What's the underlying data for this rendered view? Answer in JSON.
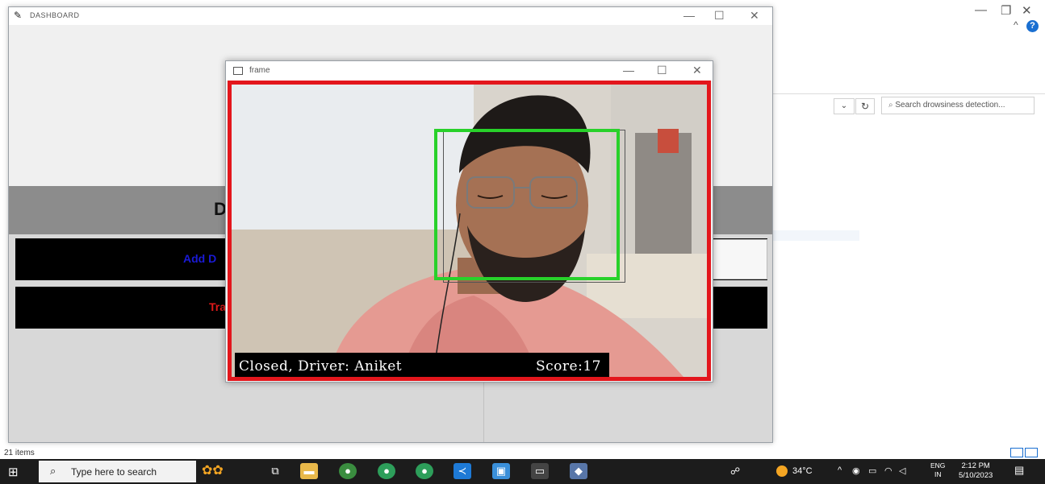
{
  "explorer": {
    "search_placeholder": "Search drowsiness detection...",
    "items_count": "21 items",
    "win_minimize": "—",
    "win_restore": "❐",
    "win_close": "✕",
    "help": "?",
    "caret": "^",
    "dropdown": "⌄",
    "refresh": "↻"
  },
  "dashboard": {
    "title": "DASHBOARD",
    "header_visible": "D",
    "add_button_visible": "Add D",
    "train_button_visible": "Tra",
    "colors": {
      "add_label": "#1a1ad6",
      "train_label": "#e01a1a",
      "header_bg": "#8c8c8c"
    },
    "win_minimize": "—",
    "win_maximize": "☐",
    "win_close": "✕"
  },
  "frame": {
    "title": "frame",
    "status": "Closed, Driver: Aniket",
    "score": "Score:17",
    "win_minimize": "—",
    "win_maximize": "☐",
    "win_close": "✕",
    "colors": {
      "border": "#e3161c",
      "face_box": "#28d12a"
    }
  },
  "taskbar": {
    "search_placeholder": "Type here to search",
    "temperature": "34°C",
    "lang_top": "ENG",
    "lang_bottom": "IN",
    "time": "2:12 PM",
    "date": "5/10/2023",
    "icons": [
      "windows-start-icon",
      "search-icon",
      "task-view-icon",
      "file-explorer-icon",
      "chrome-icon",
      "chrome-icon",
      "chrome-icon",
      "vscode-icon",
      "photos-icon",
      "terminal-icon",
      "python-icon",
      "people-icon",
      "weather-icon",
      "notification-icon"
    ]
  }
}
